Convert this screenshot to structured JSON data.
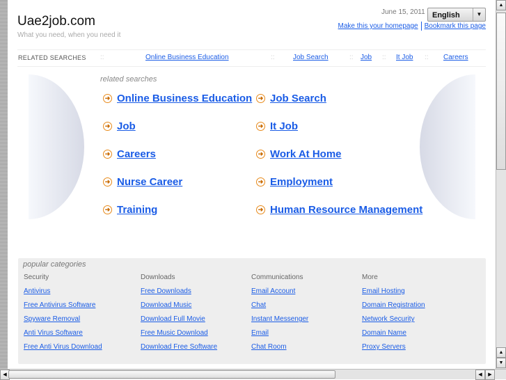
{
  "header": {
    "logo": "Uae2job.com",
    "tagline": "What you need, when you need it",
    "date": "June 15, 2011",
    "language": "English",
    "homepage_link": "Make this your homepage",
    "bookmark_link": "Bookmark this page"
  },
  "related_bar": {
    "label": "RELATED SEARCHES",
    "separator": "::",
    "links": [
      "Online Business Education",
      "Job Search",
      "Job",
      "It Job",
      "Careers"
    ]
  },
  "related": {
    "heading": "related searches",
    "items": [
      "Online Business Education",
      "Job Search",
      "Job",
      "It Job",
      "Careers",
      "Work At Home",
      "Nurse Career",
      "Employment",
      "Training",
      "Human Resource Management"
    ]
  },
  "popular": {
    "heading": "popular categories",
    "columns": [
      {
        "title": "Security",
        "links": [
          "Antivirus",
          "Free Antivirus Software",
          "Spyware Removal",
          "Anti Virus Software",
          "Free Anti Virus Download"
        ]
      },
      {
        "title": "Downloads",
        "links": [
          "Free Downloads",
          "Download Music",
          "Download Full Movie",
          "Free Music Download",
          "Download Free Software"
        ]
      },
      {
        "title": "Communications",
        "links": [
          "Email Account",
          "Chat",
          "Instant Messenger",
          "Email",
          "Chat Room"
        ]
      },
      {
        "title": "More",
        "links": [
          "Email Hosting",
          "Domain Registration",
          "Network Security",
          "Domain Name",
          "Proxy Servers"
        ]
      }
    ]
  },
  "colors": {
    "link": "#1a5ce6",
    "arrow": "#e88a1a",
    "panel": "#eeeeee"
  },
  "icons": {
    "related_item": "arrow-right-circle-icon",
    "language": "chevron-down-icon"
  }
}
